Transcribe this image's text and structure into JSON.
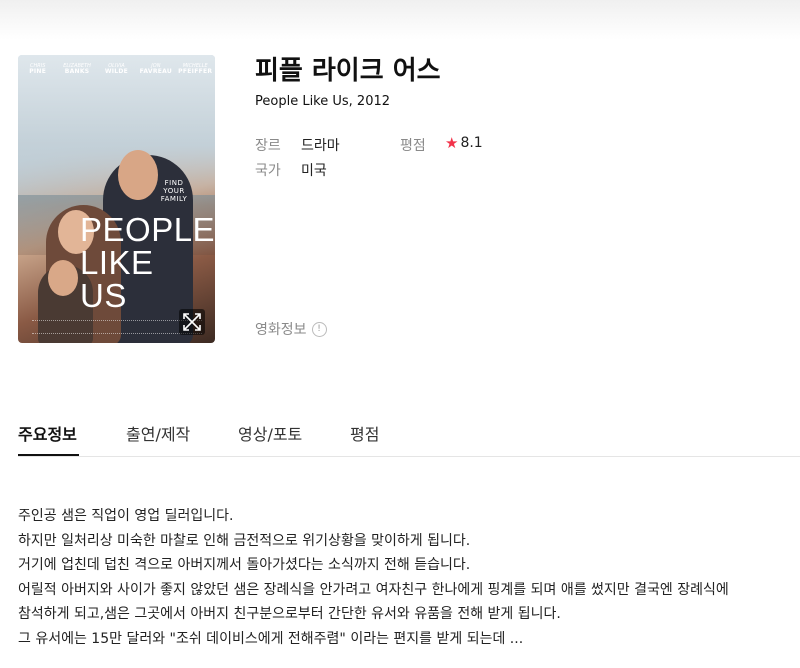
{
  "movie": {
    "title_ko": "피플 라이크 어스",
    "title_en": "People Like Us, 2012",
    "genre_label": "장르",
    "genre_value": "드라마",
    "country_label": "국가",
    "country_value": "미국",
    "rating_label": "평점",
    "rating_value": "8.1",
    "rating_icon": "star-icon",
    "rating_color": "#f2334a",
    "movie_info_label": "영화정보",
    "info_icon": "info-icon"
  },
  "poster": {
    "cast": [
      {
        "first": "CHRIS",
        "last": "PINE"
      },
      {
        "first": "ELIZABETH",
        "last": "BANKS"
      },
      {
        "first": "OLIVIA",
        "last": "WILDE"
      },
      {
        "first": "JON",
        "last": "FAVREAU"
      },
      {
        "first": "MICHELLE",
        "last": "PFEIFFER"
      }
    ],
    "tagline": "FIND YOUR FAMILY",
    "title": "PEOPLE LIKE US",
    "bottom_line": "ALL ROADS LEAD HOME",
    "expand_icon": "expand-icon"
  },
  "tabs": [
    {
      "label": "주요정보",
      "active": true
    },
    {
      "label": "출연/제작",
      "active": false
    },
    {
      "label": "영상/포토",
      "active": false
    },
    {
      "label": "평점",
      "active": false
    }
  ],
  "synopsis": [
    "주인공 샘은 직업이 영업 딜러입니다.",
    "하지만 일처리상 미숙한 마찰로 인해 금전적으로 위기상황을 맞이하게 됩니다.",
    "거기에 업친데 덥친 격으로 아버지께서 돌아가셨다는 소식까지 전해 듣습니다.",
    "어릴적 아버지와 사이가 좋지 않았던 샘은 장례식을 안가려고 여자친구 한나에게 핑계를 되며 애를 썼지만 결국엔 장례식에",
    "참석하게 되고,샘은 그곳에서 아버지 친구분으로부터 간단한 유서와 유품을 전해 받게 됩니다.",
    "그 유서에는 15만 달러와 \"조쉬 데이비스에게 전해주렴\" 이라는 편지를 받게 되는데 ..."
  ]
}
